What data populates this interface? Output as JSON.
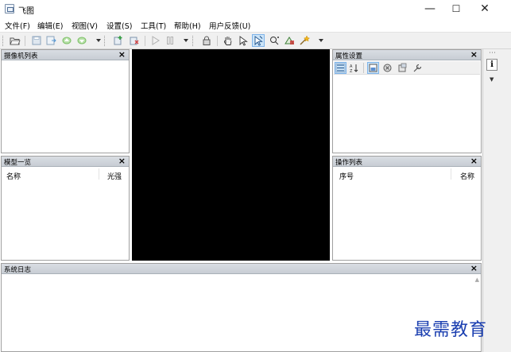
{
  "window": {
    "title": "飞图",
    "minimize_glyph": "—",
    "maximize_glyph": "☐",
    "close_glyph": "✕"
  },
  "menu": [
    "文件(F)",
    "编辑(E)",
    "视图(V)",
    "设置(S)",
    "工具(T)",
    "帮助(H)",
    "用户反馈(U)"
  ],
  "toolbar": {
    "icons": [
      "open-folder",
      "save",
      "export",
      "up-arrow",
      "down-arrow",
      "add-model",
      "remove-model",
      "play",
      "pause",
      "lock",
      "hand-pan",
      "pointer-select",
      "select-tool",
      "zoom",
      "measure",
      "effects"
    ],
    "active_icon": "select-tool"
  },
  "panels": {
    "camera_list": {
      "title": "摄像机列表"
    },
    "model_list": {
      "title": "模型一览",
      "columns": [
        "名称",
        "光强"
      ]
    },
    "properties": {
      "title": "属性设置",
      "tools": [
        "sort-category",
        "sort-alpha",
        "property-pages",
        "events",
        "settings",
        "wrench"
      ]
    },
    "operations": {
      "title": "操作列表",
      "columns": [
        "序号",
        "名称"
      ]
    },
    "system_log": {
      "title": "系统日志"
    }
  },
  "close_glyph": "×",
  "right_strip": {
    "tab_label": "i",
    "menu_glyph": "▼",
    "pin_glyph": "⋯"
  },
  "watermark": "最需教育",
  "colors": {
    "viewport": "#000000",
    "panel_header": "#d0d4da",
    "accent": "#1b3fb0"
  }
}
